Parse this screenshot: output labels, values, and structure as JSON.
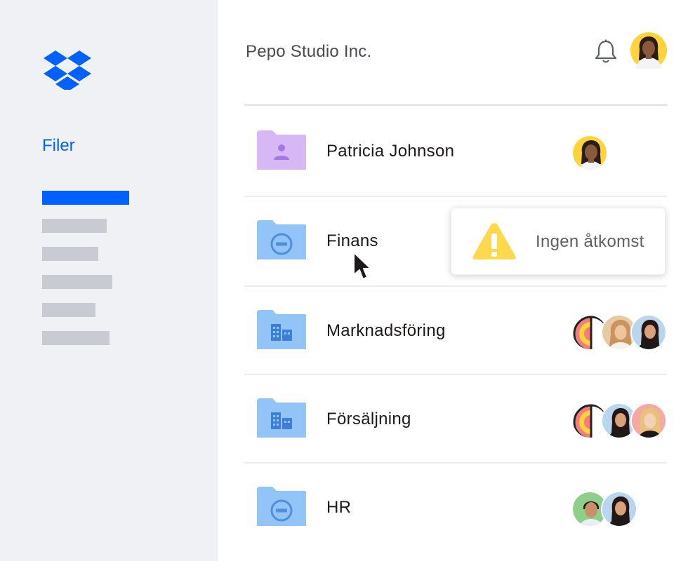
{
  "sidebar": {
    "logo": "dropbox-logo",
    "nav_title": "Filer",
    "accent": "#0061fe"
  },
  "header": {
    "org_name": "Pepo Studio Inc.",
    "bell_icon": "bell-icon"
  },
  "folders": [
    {
      "name": "Patricia Johnson",
      "icon": "person-folder-icon",
      "color": "#d7b8f5"
    },
    {
      "name": "Finans",
      "icon": "blocked-folder-icon",
      "color": "#92c4f7"
    },
    {
      "name": "Marknadsföring",
      "icon": "team-folder-icon",
      "color": "#92c4f7"
    },
    {
      "name": "Försäljning",
      "icon": "team-folder-icon",
      "color": "#92c4f7"
    },
    {
      "name": "HR",
      "icon": "blocked-folder-icon",
      "color": "#92c4f7"
    }
  ],
  "toast": {
    "icon": "warning-icon",
    "message": "Ingen åtkomst",
    "icon_color": "#ffd84d"
  }
}
